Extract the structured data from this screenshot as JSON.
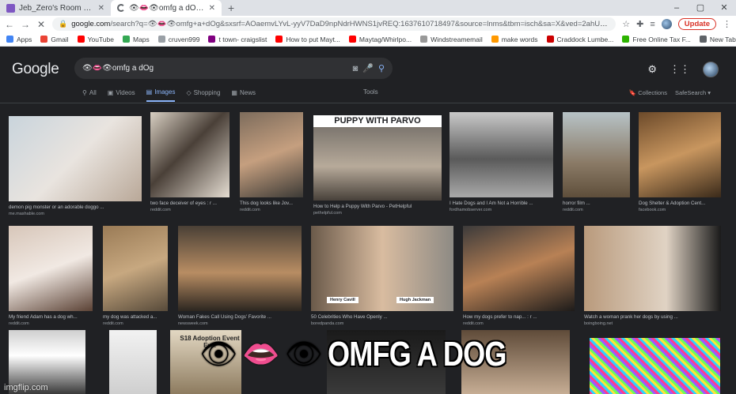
{
  "browser": {
    "tabs": [
      {
        "title": "Jeb_Zero's Room - Hyperte",
        "active": false
      },
      {
        "title": "👁👄👁omfg a dOg - Google Se",
        "active": true
      }
    ],
    "new_tab": "+",
    "window_controls": [
      "–",
      "▢",
      "✕"
    ],
    "url_host": "google.com",
    "url_path": "/search?q=👁👄👁omfg+a+dOg&sxsrf=AOaemvLYvL-yyV7DaD9npNdrHWNS1jvREQ:1637610718497&source=lnms&tbm=isch&sa=X&ved=2ahUKEwj7q5-p36z0AhVnkmoFHXd-A7sQ_A...",
    "update_label": "Update",
    "bookmarks": [
      {
        "label": "Apps",
        "color": "#4285f4"
      },
      {
        "label": "Gmail",
        "color": "#ea4335"
      },
      {
        "label": "YouTube",
        "color": "#ff0000"
      },
      {
        "label": "Maps",
        "color": "#34a853"
      },
      {
        "label": "cruven999",
        "color": "#9aa0a6"
      },
      {
        "label": "t town- craigslist",
        "color": "#800080"
      },
      {
        "label": "How to put Mayt...",
        "color": "#ff0000"
      },
      {
        "label": "Maytag/Whirlpo...",
        "color": "#ff0000"
      },
      {
        "label": "Windstreamemail",
        "color": "#999999"
      },
      {
        "label": "make words",
        "color": "#ff9900"
      },
      {
        "label": "Craddock Lumbe...",
        "color": "#cc0000"
      },
      {
        "label": "Free Online Tax F...",
        "color": "#2db300"
      },
      {
        "label": "New Tab",
        "color": "#5f6368"
      }
    ]
  },
  "google": {
    "logo": "Google",
    "query": "👁👄👁omfg a dOg",
    "tabs": [
      "All",
      "Videos",
      "Images",
      "Shopping",
      "News"
    ],
    "active_tab": "Images",
    "tools": "Tools",
    "collections": "Collections",
    "safesearch": "SafeSearch ▾"
  },
  "results": [
    {
      "caption": "demon pig monster or an adorable doggo ...",
      "source": "me.mashable.com"
    },
    {
      "caption": "two face deceiver of eyes : r ...",
      "source": "reddit.com"
    },
    {
      "caption": "This dog looks like Jov...",
      "source": "reddit.com"
    },
    {
      "caption": "How to Help a Puppy With Parvo - PetHelpful",
      "source": "pethelpful.com",
      "banner": "PUPPY WITH PARVO"
    },
    {
      "caption": "I Hate Dogs and I Am Not a Horrible ...",
      "source": "fordhamobserver.com"
    },
    {
      "caption": "horror film ...",
      "source": "reddit.com"
    },
    {
      "caption": "Dog Shelter & Adoption Cent...",
      "source": "facebook.com"
    },
    {
      "caption": "My friend Adam has a dog wh...",
      "source": "reddit.com"
    },
    {
      "caption": "my dog was attacked a...",
      "source": "reddit.com"
    },
    {
      "caption": "Woman Fakes Call Using Dogs' Favorite ...",
      "source": "newsweek.com"
    },
    {
      "caption": "50 Celebrities Who Have Openly ...",
      "source": "boredpanda.com",
      "labels": [
        "Henry Cavill",
        "Hugh Jackman"
      ]
    },
    {
      "caption": "How my dogs prefer to nap... : r ...",
      "source": "reddit.com"
    },
    {
      "caption": "Watch a woman prank her dogs by using ...",
      "source": "boingboing.net"
    },
    {
      "caption": "",
      "source": ""
    },
    {
      "caption": "",
      "source": ""
    },
    {
      "caption": "",
      "source": "",
      "sign": "S18 Adoption Event Ev..."
    },
    {
      "caption": "",
      "source": ""
    },
    {
      "caption": "",
      "source": ""
    },
    {
      "caption": "",
      "source": ""
    }
  ],
  "meme": {
    "emoji_left": "👁",
    "emoji_mid": "👄",
    "emoji_right": "👁",
    "text": "OMFG A DOG"
  },
  "watermark": "imgflip.com"
}
